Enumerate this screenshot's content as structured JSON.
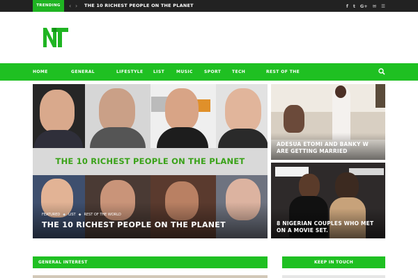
{
  "topbar": {
    "trending_label": "TRENDING",
    "ticker_headline": "THE 10 RICHEST PEOPLE ON THE PLANET",
    "prev_arrow": "‹",
    "next_arrow": "›",
    "socials": [
      "f",
      "t",
      "G+",
      "✉",
      "☰"
    ]
  },
  "nav": {
    "items": [
      "HOME",
      "GENERAL",
      "LIFESTYLE",
      "LIST",
      "MUSIC",
      "SPORT",
      "TECH",
      "REST OF THE"
    ]
  },
  "hero": {
    "banner_text": "THE 10 RICHEST PEOPLE ON THE PLANET",
    "categories": [
      "FEATURED",
      "LIST",
      "REST OF THE WORLD"
    ],
    "title": "THE 10 RICHEST PEOPLE ON THE PLANET"
  },
  "side_posts": [
    {
      "title_line1": "ADESUA ETOMI AND BANKY W",
      "title_line2": "ARE GETTING MARRIED"
    },
    {
      "title_line1": "8 NIGERIAN COUPLES WHO MET",
      "title_line2": "ON A MOVIE SET."
    }
  ],
  "sections": {
    "left_title": "GENERAL INTEREST",
    "right_title": "KEEP IN TOUCH"
  },
  "colors": {
    "brand_green": "#1fc022",
    "topbar_bg": "#222222",
    "banner_green_text": "#3aa219"
  }
}
